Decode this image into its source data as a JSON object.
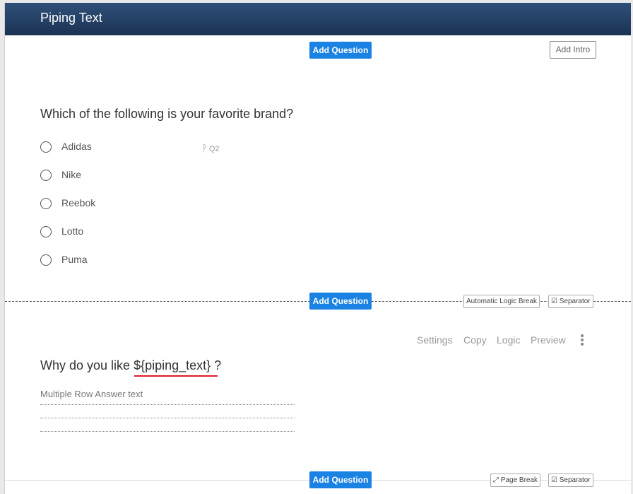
{
  "window": {
    "title": "Piping Text"
  },
  "buttons": {
    "add_question": "Add Question",
    "add_intro": "Add Intro",
    "automatic_logic_break": "Automatic Logic Break",
    "separator": "Separator",
    "page_break": "Page Break"
  },
  "question1": {
    "title": "Which of the following is your favorite brand?",
    "number_tag": "Q2",
    "options": [
      "Adidas",
      "Nike",
      "Reebok",
      "Lotto",
      "Puma"
    ]
  },
  "question2": {
    "title_prefix": "Why do you like ",
    "piping_token": "${piping_text}",
    "title_suffix": " ?",
    "answer_placeholder": "Multiple Row Answer text",
    "toolbar": [
      "Settings",
      "Copy",
      "Logic",
      "Preview"
    ]
  },
  "icons": {
    "branch": "branch-icon",
    "checkbox": "checkbox-icon",
    "page_break": "page-break-icon",
    "more": "kebab-menu-icon"
  },
  "colors": {
    "header": "#1f3a5f",
    "primary": "#1a82e2",
    "piping_underline": "#e01b2a"
  }
}
